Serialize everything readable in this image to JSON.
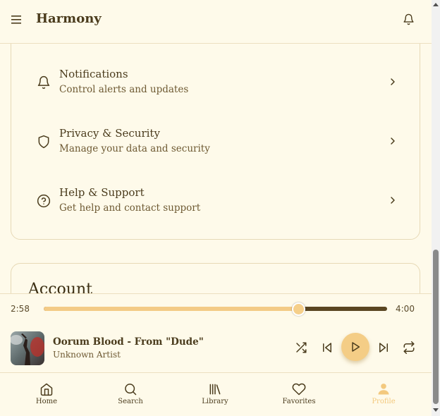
{
  "app": {
    "title": "Harmony"
  },
  "settings": {
    "items": [
      {
        "title": "Notifications",
        "subtitle": "Control alerts and updates",
        "icon": "bell-icon"
      },
      {
        "title": "Privacy & Security",
        "subtitle": "Manage your data and security",
        "icon": "shield-icon"
      },
      {
        "title": "Help & Support",
        "subtitle": "Get help and contact support",
        "icon": "help-circle-icon"
      }
    ]
  },
  "account": {
    "title": "Account"
  },
  "player": {
    "current_time": "2:58",
    "total_time": "4:00",
    "progress_fraction": 0.7417,
    "song_title": "Oorum Blood - From \"Dude\"",
    "artist": "Unknown Artist",
    "controls": [
      "shuffle-icon",
      "previous-icon",
      "play-icon",
      "next-icon",
      "repeat-icon"
    ]
  },
  "nav": {
    "items": [
      {
        "label": "Home",
        "icon": "home-icon"
      },
      {
        "label": "Search",
        "icon": "search-icon"
      },
      {
        "label": "Library",
        "icon": "library-icon"
      },
      {
        "label": "Favorites",
        "icon": "heart-icon"
      },
      {
        "label": "Profile",
        "icon": "profile-icon",
        "active": true
      }
    ]
  },
  "colors": {
    "background": "#fefaea",
    "text": "#4a3b1c",
    "accent": "#f3cb86",
    "track_remaining": "#5a4622"
  }
}
